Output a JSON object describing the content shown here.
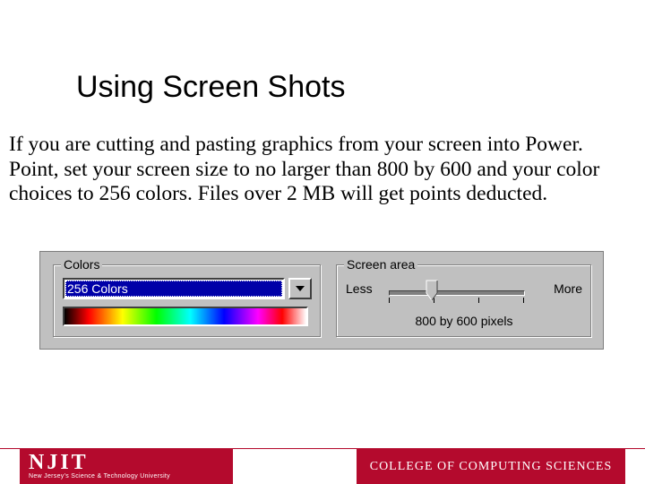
{
  "title": "Using Screen Shots",
  "body_text": "If you are cutting and pasting graphics from your screen into Power. Point, set your screen size to no larger than 800 by 600 and your color choices to 256 colors.  Files over 2 MB will get points deducted.",
  "panel": {
    "colors_group_label": "Colors",
    "dropdown_value": "256 Colors",
    "screen_group_label": "Screen area",
    "less_label": "Less",
    "more_label": "More",
    "resolution_label": "800 by 600 pixels"
  },
  "footer": {
    "njit": "NJIT",
    "njit_sub": "New Jersey's Science & Technology University",
    "college": "COLLEGE OF COMPUTING SCIENCES"
  }
}
